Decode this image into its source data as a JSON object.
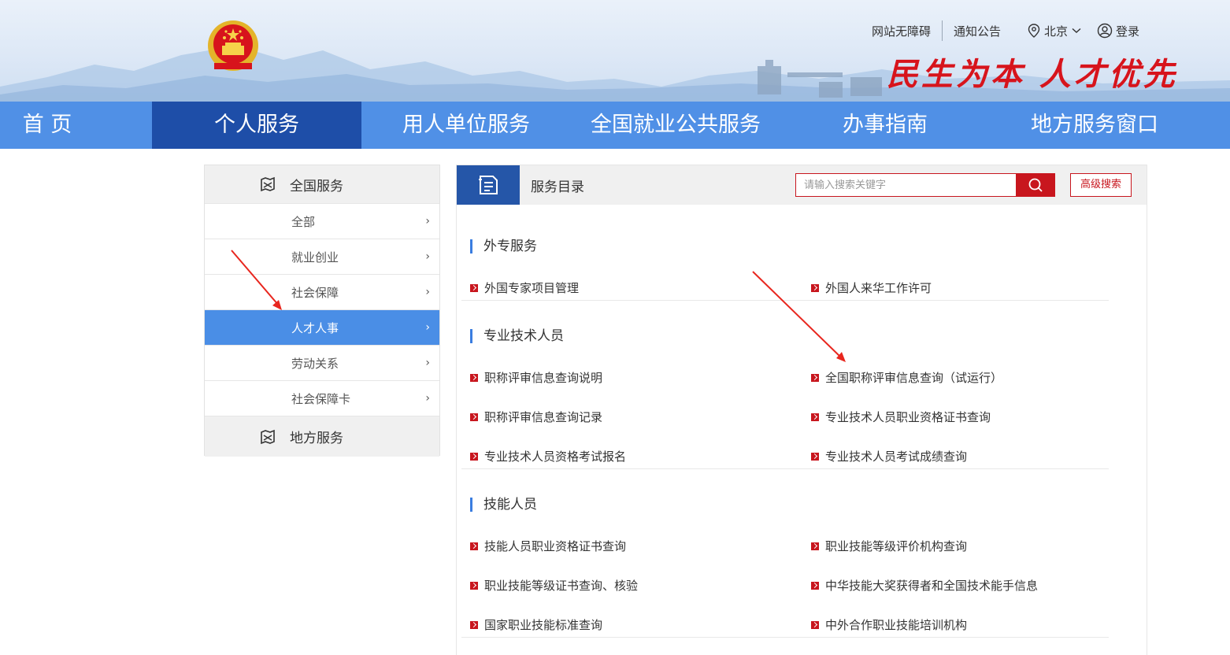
{
  "header": {
    "accessibility_link": "网站无障碍",
    "notice_link": "通知公告",
    "location": "北京",
    "login": "登录",
    "slogan": "民生为本 人才优先",
    "accent_color": "#d7141c"
  },
  "nav": {
    "items": [
      {
        "label": "首 页",
        "active": false
      },
      {
        "label": "个人服务",
        "active": true
      },
      {
        "label": "用人单位服务",
        "active": false
      },
      {
        "label": "全国就业公共服务",
        "active": false
      },
      {
        "label": "办事指南",
        "active": false
      },
      {
        "label": "地方服务窗口",
        "active": false
      }
    ],
    "bg_color": "#5090e6",
    "active_color": "#1e4ea8"
  },
  "sidebar": {
    "national_header": "全国服务",
    "items": [
      {
        "label": "全部",
        "active": false
      },
      {
        "label": "就业创业",
        "active": false
      },
      {
        "label": "社会保障",
        "active": false
      },
      {
        "label": "人才人事",
        "active": true
      },
      {
        "label": "劳动关系",
        "active": false
      },
      {
        "label": "社会保障卡",
        "active": false
      }
    ],
    "local_header": "地方服务",
    "chevron": "›"
  },
  "catalog": {
    "title": "服务目录",
    "search_placeholder": "请输入搜索关键字",
    "advanced_search": "高级搜索",
    "sections": [
      {
        "title": "外专服务",
        "items": [
          "外国专家项目管理",
          "外国人来华工作许可"
        ]
      },
      {
        "title": "专业技术人员",
        "items": [
          "职称评审信息查询说明",
          "全国职称评审信息查询（试运行）",
          "职称评审信息查询记录",
          "专业技术人员职业资格证书查询",
          "专业技术人员资格考试报名",
          "专业技术人员考试成绩查询"
        ]
      },
      {
        "title": "技能人员",
        "items": [
          "技能人员职业资格证书查询",
          "职业技能等级评价机构查询",
          "职业技能等级证书查询、核验",
          "中华技能大奖获得者和全国技术能手信息",
          "国家职业技能标准查询",
          "中外合作职业技能培训机构"
        ]
      }
    ]
  }
}
